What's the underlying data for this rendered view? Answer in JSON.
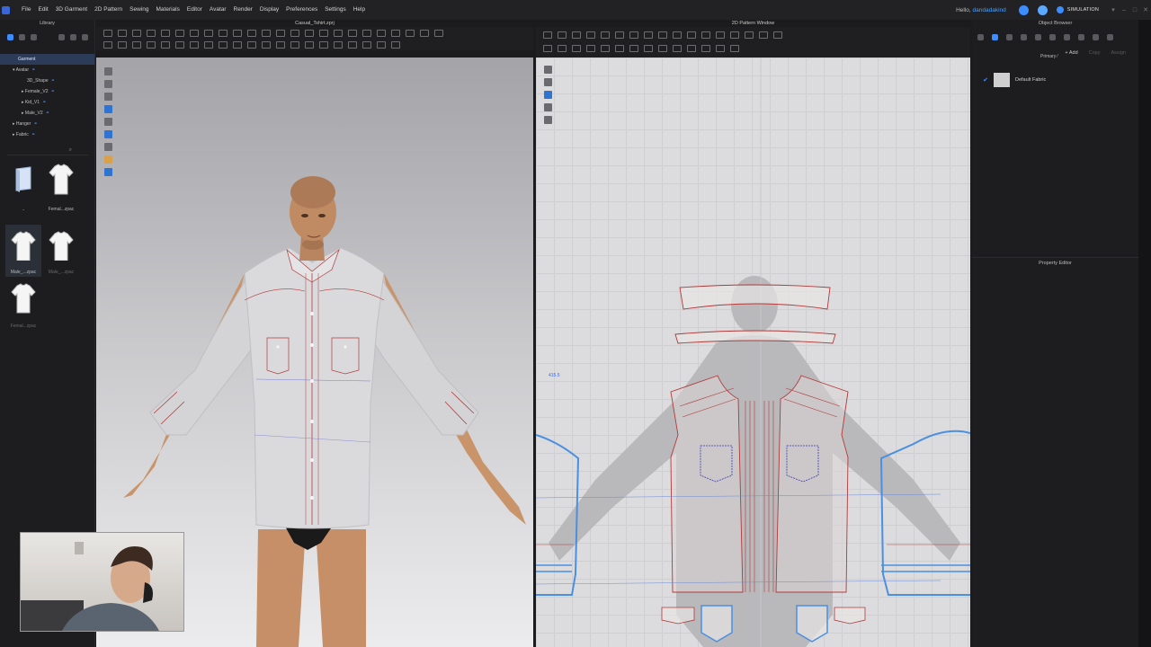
{
  "menu": [
    "File",
    "Edit",
    "3D Garment",
    "2D Pattern",
    "Sewing",
    "Materials",
    "Editor",
    "Avatar",
    "Render",
    "Display",
    "Preferences",
    "Settings",
    "Help"
  ],
  "user": {
    "hello": "Hello,",
    "name": "dandadakind"
  },
  "simulation_label": "SIMULATION",
  "library": {
    "title": "Library",
    "tree": [
      {
        "label": "Garment",
        "selected": true
      },
      {
        "label": "Avatar"
      },
      {
        "label": "3D_Shape"
      },
      {
        "label": "Female_V2"
      },
      {
        "label": "Kid_V1"
      },
      {
        "label": "Male_V2"
      },
      {
        "label": "Hanger"
      },
      {
        "label": "Fabric"
      }
    ],
    "thumbnails": [
      {
        "label": "..",
        "kind": "folder"
      },
      {
        "label": "Femal...zpac",
        "kind": "tshirt"
      },
      {
        "label": "Male_...zpac",
        "kind": "tshirt",
        "selected": true
      },
      {
        "label": "Male_...zpac",
        "kind": "tshirt",
        "dim": true
      },
      {
        "label": "Femal...zpac",
        "kind": "tshirt",
        "dim": true
      }
    ]
  },
  "viewport3d": {
    "title": "Casual_Tshirt.zprj"
  },
  "viewport2d": {
    "title": "2D Pattern Window",
    "scale_label": "415.5"
  },
  "object_browser": {
    "title": "Object Browser",
    "primary": "Primary",
    "add": "+ Add",
    "copy": "Copy",
    "assign": "Assign",
    "fabric": "Default Fabric"
  },
  "property_editor": {
    "title": "Property Editor"
  },
  "colors": {
    "accent": "#3c8dff",
    "seam": "#b03a3a",
    "pattern_blue": "#4a8fe0"
  }
}
